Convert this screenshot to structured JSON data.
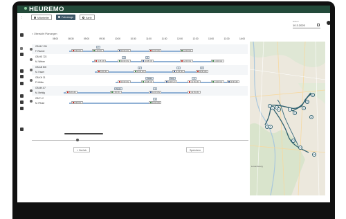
{
  "app": {
    "brand": "HEUREMO"
  },
  "toolbar": {
    "buttons": [
      {
        "label": "Mitarbeiter"
      },
      {
        "label": "Fahrzeuge"
      },
      {
        "label": "Karte"
      }
    ]
  },
  "breadcrumb": "< Übersicht Planungen",
  "date": {
    "label": "Datum",
    "value": "10.3.2020"
  },
  "timeline": {
    "ticks": [
      "08:00",
      "08:30",
      "09:00",
      "09:30",
      "10:00",
      "10:30",
      "11:00",
      "11:30",
      "12:00",
      "12:30",
      "13:00",
      "13:30",
      "14:00"
    ],
    "vehicles": [
      {
        "plate": "OB-MV 196",
        "driver": "F. Rachel",
        "stops": [
          "8:30 Uhr",
          "9:10 Uhr",
          "10:00 Uhr",
          "11:00 Uhr",
          "12:00 Uhr"
        ],
        "bubbles": [
          "2"
        ]
      },
      {
        "plate": "OB-HS 723",
        "driver": "M. Weber",
        "stops": [
          "9:15 Uhr",
          "10:00 Uhr",
          "10:45 Uhr",
          "12:00 Uhr",
          "13:00 Uhr"
        ],
        "bubbles": [
          "1",
          "3"
        ]
      },
      {
        "plate": "OB-AB 500",
        "driver": "M. Hauer",
        "stops": [
          "9:20 Uhr",
          "10:30 Uhr",
          "11:45 Uhr",
          "12:30 Uhr"
        ],
        "bubbles": [
          "2",
          "1",
          "3"
        ]
      },
      {
        "plate": "OB-KH 31",
        "driver": "P. Müller",
        "stops": [
          "10:00 Uhr",
          "10:45 Uhr",
          "11:30 Uhr",
          "12:15 Uhr",
          "13:00 Uhr",
          "13:30 Uhr"
        ],
        "bubbles": [
          "Pause",
          "Stop",
          "2"
        ]
      },
      {
        "plate": "OB-MK 87",
        "driver": "M. Mehlig",
        "stops": [
          "8:20 Uhr",
          "9:45 Uhr",
          "11:00 Uhr",
          "12:15 Uhr"
        ],
        "bubbles": [
          "Pause",
          "1"
        ]
      },
      {
        "plate": "OB-TL 2",
        "driver": "M. Pfister",
        "stops": [
          "8:30 Uhr",
          "11:00 Uhr"
        ],
        "bubbles": [
          "1"
        ]
      }
    ]
  },
  "actions": {
    "left": "< Zurück",
    "right": "Speichern"
  },
  "map": {
    "labels": [
      "Luxembourg"
    ],
    "markers": [
      "1",
      "2",
      "3",
      "4",
      "5",
      "6",
      "7",
      "8",
      "9",
      "10",
      "11",
      "12",
      "13",
      "14",
      "15"
    ]
  },
  "colors": {
    "appbar": "#234a3a",
    "route": "#8fb0d4",
    "marker_red": "#d0312d",
    "marker_green": "#3c8b4a",
    "marker_blue": "#3a5f9a",
    "map_route": "#2d5f6e"
  },
  "icons": [
    "settings-icon",
    "menu-icon",
    "calendar-icon",
    "sidebar-icons"
  ]
}
